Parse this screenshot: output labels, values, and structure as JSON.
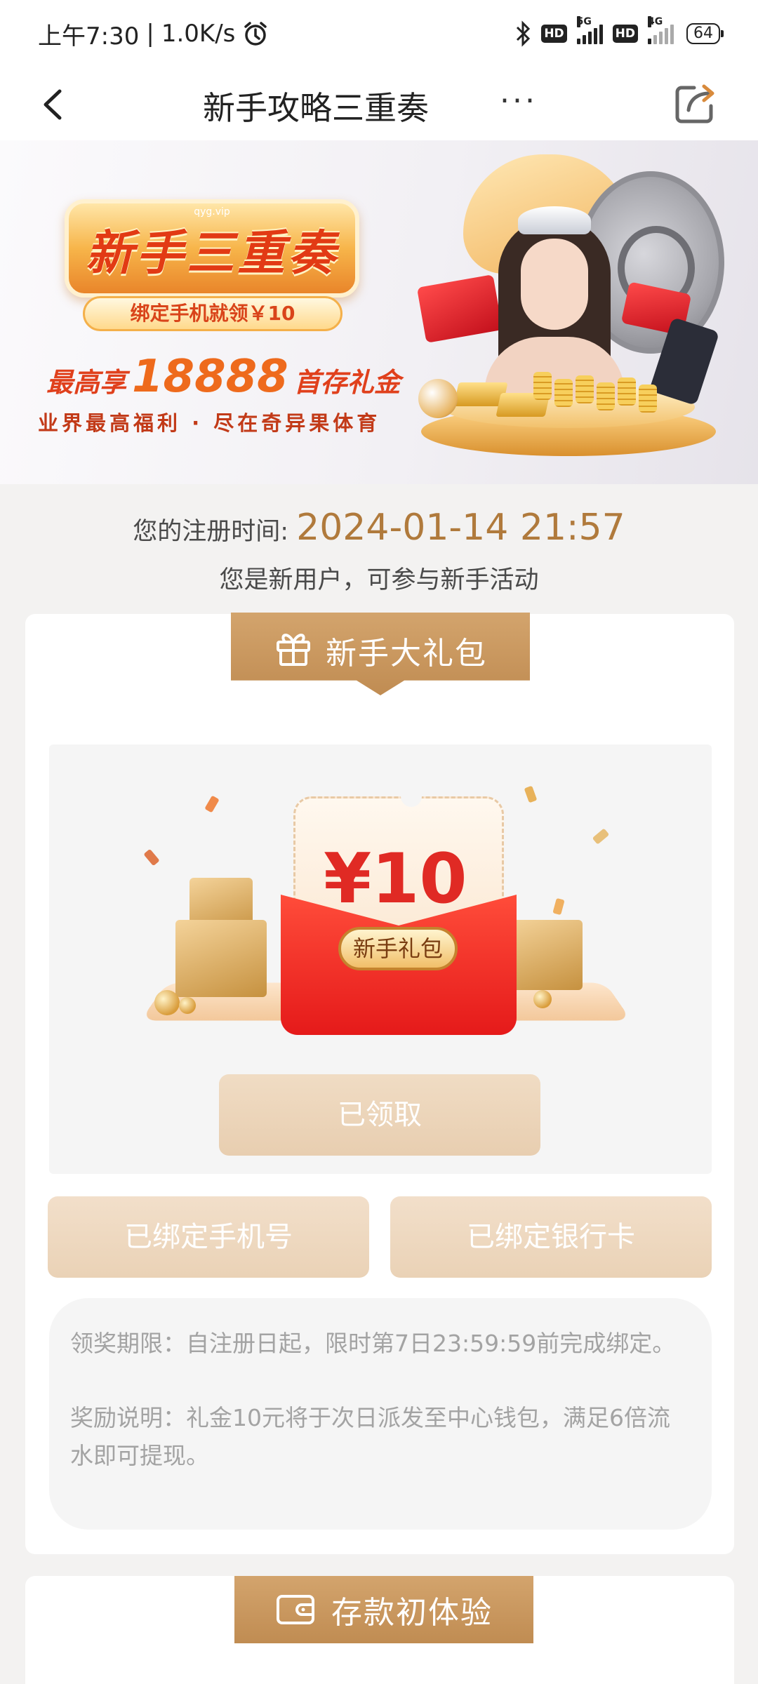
{
  "status_bar": {
    "time": "上午7:30",
    "speed": "1.0K/s",
    "alarm_icon": "alarm-clock-icon",
    "bluetooth_icon": "bluetooth-icon",
    "network_1": "5G",
    "network_2": "4G",
    "hd_label": "HD",
    "battery": "64"
  },
  "nav": {
    "title": "新手攻略三重奏",
    "more": "...",
    "back_icon": "chevron-left-icon",
    "share_icon": "share-icon"
  },
  "banner": {
    "url": "qyg.vip",
    "title": "新手三重奏",
    "subtitle": "绑定手机就领￥10",
    "line_prefix": "最高享",
    "line_number": "18888",
    "line_suffix": "首存礼金",
    "slogan": "业界最高福利 · 尽在奇异果体育"
  },
  "registration": {
    "label": "您的注册时间:",
    "time": "2024-01-14 21:57",
    "note": "您是新用户，可参与新手活动"
  },
  "gift_card": {
    "ribbon_label": "新手大礼包",
    "ribbon_icon": "gift-icon",
    "amount": "¥10",
    "badge": "新手礼包",
    "claimed_button": "已领取",
    "bind_phone_button": "已绑定手机号",
    "bind_bank_button": "已绑定银行卡",
    "rule_period": "领奖期限：自注册日起，限时第7日23:59:59前完成绑定。",
    "rule_reward": "奖励说明：礼金10元将于次日派发至中心钱包，满足6倍流水即可提现。"
  },
  "deposit_card": {
    "ribbon_label": "存款初体验",
    "ribbon_icon": "wallet-icon"
  },
  "colors": {
    "accent_gold": "#c08c52",
    "time_color": "#b07a3c",
    "red": "#e02a24",
    "button_disabled": "#ead2b6"
  }
}
